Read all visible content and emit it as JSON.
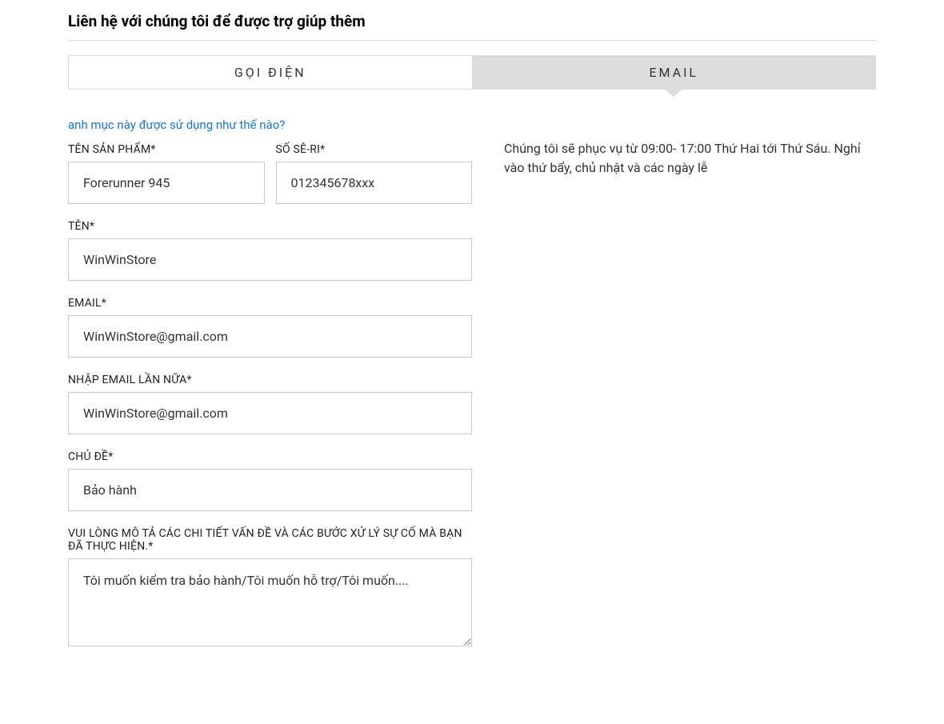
{
  "header": {
    "title": "Liên hệ với chúng tôi để được trợ giúp thêm"
  },
  "tabs": {
    "call": "GỌI ĐIỆN",
    "email": "EMAIL"
  },
  "form": {
    "help_link": "anh mục này được sử dụng như thế nào?",
    "product_name": {
      "label": "TÊN SẢN PHẨM*",
      "value": "Forerunner 945"
    },
    "serial": {
      "label": "SỐ SÊ-RI*",
      "value": "012345678xxx"
    },
    "name": {
      "label": "TÊN*",
      "value": "WinWinStore"
    },
    "email": {
      "label": "EMAIL*",
      "value": "WinWinStore@gmail.com"
    },
    "email_confirm": {
      "label": "NHẬP EMAIL LẦN NỮA*",
      "value": "WinWinStore@gmail.com"
    },
    "subject": {
      "label": "CHỦ ĐỀ*",
      "value": "Bảo hành"
    },
    "description": {
      "label": "VUI LÒNG MÔ TẢ CÁC CHI TIẾT VẤN ĐỀ VÀ CÁC BƯỚC XỬ LÝ SỰ CỐ MÀ BẠN ĐÃ THỰC HIỆN.*",
      "value": "Tôi muốn kiểm tra bảo hành/Tôi muốn hỗ trợ/Tôi muốn...."
    }
  },
  "info": {
    "hours": "Chúng tôi sẽ phục vụ từ 09:00- 17:00 Thứ Hai tới Thứ Sáu. Nghỉ vào thứ bẩy, chủ nhật và các ngày lễ"
  }
}
